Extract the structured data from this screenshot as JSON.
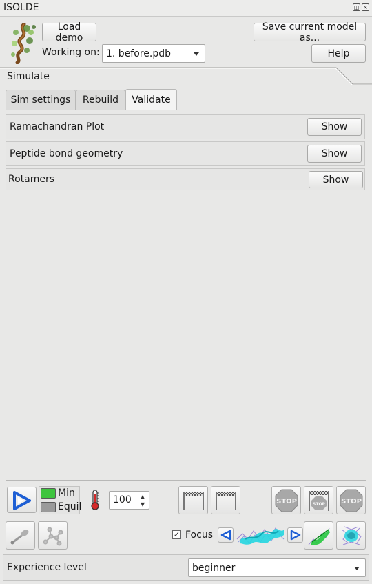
{
  "window": {
    "title": "ISOLDE",
    "float_icon": "restore-icon",
    "close_icon": "close-icon"
  },
  "top": {
    "load_demo_label": "Load demo",
    "save_model_label": "Save current model as...",
    "working_on_label": "Working on:",
    "working_on_value": "1. before.pdb",
    "help_label": "Help"
  },
  "section": {
    "title": "Simulate"
  },
  "tabs": [
    {
      "label": "Sim settings",
      "active": false
    },
    {
      "label": "Rebuild",
      "active": false
    },
    {
      "label": "Validate",
      "active": true
    }
  ],
  "validate": {
    "rows": [
      {
        "label": "Ramachandran Plot",
        "button": "Show"
      },
      {
        "label": "Peptide bond geometry",
        "button": "Show"
      },
      {
        "label": "Rotamers",
        "button": "Show"
      }
    ]
  },
  "controls": {
    "min_label": "Min",
    "equil_label": "Equil",
    "min_color": "#3ec43e",
    "equil_color": "#9a9a9a",
    "temperature_value": "100",
    "focus_label": "Focus",
    "focus_checked": true
  },
  "footer": {
    "experience_label": "Experience level",
    "experience_value": "beginner"
  },
  "colors": {
    "play_blue": "#1e5fd4",
    "stop_gray": "#a8a8a8",
    "cyan_map": "#25d6e0",
    "green_map": "#27c93f"
  }
}
